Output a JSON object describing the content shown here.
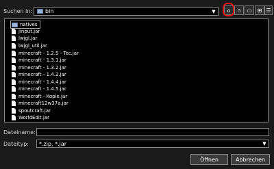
{
  "lookin": {
    "label": "Suchen in:",
    "value": "bin"
  },
  "toolbar": {
    "up_icon": "up-folder-icon",
    "home_icon": "home-icon",
    "new_icon": "new-folder-icon",
    "list_icon": "list-view-icon",
    "details_icon": "details-view-icon"
  },
  "files": [
    "natives",
    "jinput.jar",
    "lwjgl.jar",
    "lwjgl_util.jar",
    "minecraft - 1.2.5 - Tec.jar",
    "minecraft - 1.3.1.jar",
    "minecraft - 1.3.2.jar",
    "minecraft - 1.4.2.jar",
    "minecraft - 1.4.4.jar",
    "minecraft - 1.4.5.jar",
    "minecraft - Kopie.jar",
    "minecraft12w37a.jar",
    "spoutcraft.jar",
    "WorldEdit.jar"
  ],
  "filename": {
    "label": "Dateiname:",
    "value": ""
  },
  "filetype": {
    "label": "Dateityp:",
    "value": "*.zip, *.jar"
  },
  "buttons": {
    "open": "Öffnen",
    "cancel": "Abbrechen"
  },
  "colors": {
    "highlight": "#e01818",
    "background": "#1a1a1a"
  }
}
